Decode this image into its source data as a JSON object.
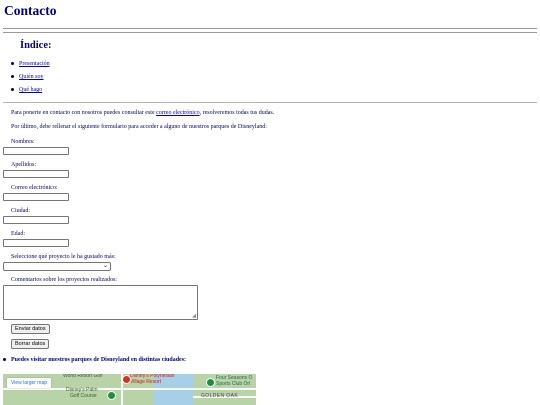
{
  "page": {
    "title": "Contacto"
  },
  "index": {
    "title": "Índice:",
    "items": [
      "Presentación",
      "Quién soy",
      "Qué hago"
    ]
  },
  "intro": {
    "before_link": "Para ponerte en contacto con nosotros puedes consultar este ",
    "link_text": "correo electrónico",
    "after_link": ", resolveremos todas tus dudas.",
    "form_intro": "Por último, debe rellenar el siguiente formulario para acceder a alguno de nuestros parques de Disneyland:"
  },
  "form": {
    "name_label": "Nombres:",
    "surname_label": "Apellidos:",
    "email_label": "Correo electrónico:",
    "city_label": "Ciudad:",
    "age_label": "Edad:",
    "project_label": "Seleccione qué proyecto le ha gustado más:",
    "project_selected": "",
    "comments_label": "Comentarios sobre los proyectos realizados:",
    "submit_label": "Enviar datos",
    "reset_label": "Borrar datos"
  },
  "parks": {
    "title": "Puedes visitar nuestros parques de Disneyland en distintas ciudades:"
  },
  "map": {
    "view_larger": "View larger map",
    "labels": {
      "world_resort": "World Resort Golf",
      "polynesian_1": "Disney's Polynesian",
      "polynesian_2": "Village Resort",
      "palm_1": "Disney's Palm",
      "palm_2": "Golf Course",
      "four_seasons_1": "Four Seasons O",
      "four_seasons_2": "Sports Club Orl",
      "golden_oak": "GOLDEN OAK"
    },
    "colors": {
      "land": "#b9d3a8",
      "water": "#a8cfe8",
      "link": "#1a73e8"
    }
  },
  "colors": {
    "heading": "#000080",
    "text": "#000066",
    "link": "#0000cc"
  }
}
